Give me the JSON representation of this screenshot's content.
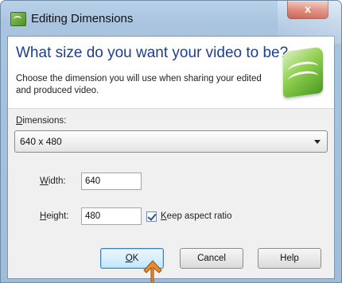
{
  "window": {
    "title": "Editing Dimensions",
    "close_label": "x"
  },
  "header": {
    "heading": "What size do you want your video to be?",
    "subtext": "Choose the dimension you will use when sharing your edited and produced video."
  },
  "dimensions": {
    "label_mnemonic": "D",
    "label_rest": "imensions:",
    "selected_value": "640 x 480"
  },
  "width": {
    "label_mnemonic": "W",
    "label_rest": "idth:",
    "value": "640"
  },
  "height": {
    "label_mnemonic": "H",
    "label_rest": "eight:",
    "value": "480"
  },
  "aspect": {
    "checked": true,
    "label_mnemonic": "K",
    "label_rest": "eep aspect ratio"
  },
  "buttons": {
    "ok_mnemonic": "O",
    "ok_rest": "K",
    "cancel": "Cancel",
    "help": "Help"
  },
  "colors": {
    "heading": "#1e3f8a",
    "accent_arrow": "#e88a2e"
  }
}
